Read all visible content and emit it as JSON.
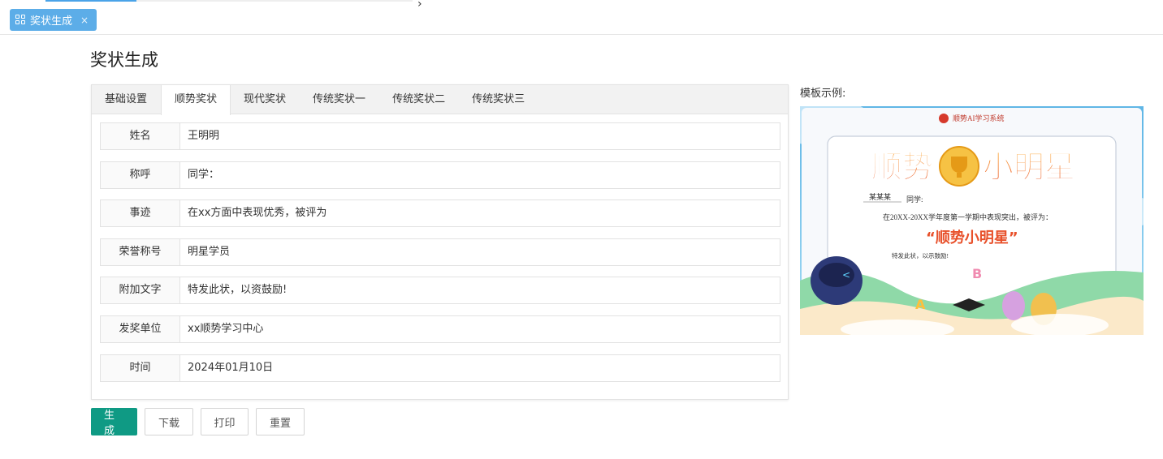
{
  "top_tab": {
    "label": "奖状生成",
    "close": "×"
  },
  "page": {
    "title": "奖状生成"
  },
  "tabs": [
    {
      "label": "基础设置"
    },
    {
      "label": "顺势奖状"
    },
    {
      "label": "现代奖状"
    },
    {
      "label": "传统奖状一"
    },
    {
      "label": "传统奖状二"
    },
    {
      "label": "传统奖状三"
    }
  ],
  "active_tab": "顺势奖状",
  "form": {
    "name": {
      "label": "姓名",
      "value": "王明明"
    },
    "salutation": {
      "label": "称呼",
      "value": "同学："
    },
    "deeds": {
      "label": "事迹",
      "value": "在xx方面中表现优秀，被评为"
    },
    "honor": {
      "label": "荣誉称号",
      "value": "明星学员"
    },
    "extra": {
      "label": "附加文字",
      "value": "特发此状，以资鼓励!"
    },
    "issuer": {
      "label": "发奖单位",
      "value": "xx顺势学习中心"
    },
    "date": {
      "label": "时间",
      "value": "2024年01月10日"
    }
  },
  "buttons": {
    "generate": "生成",
    "download": "下载",
    "print": "打印",
    "reset": "重置"
  },
  "preview": {
    "label": "模板示例:",
    "header": "顺势AI学习系统",
    "headline_left": "顺势",
    "headline_right": "小明星",
    "recipient": "某某某",
    "salutation": "同学:",
    "body": "在20XX-20XX学年度第一学期中表现突出，被评为：",
    "honor": "“顺势小明星”",
    "closing": "特发此状，以示鼓励!"
  },
  "colors": {
    "tab_accent": "#5cade8",
    "primary": "#0f9a84",
    "headline": "#e8502a",
    "honor": "#e8502a"
  }
}
